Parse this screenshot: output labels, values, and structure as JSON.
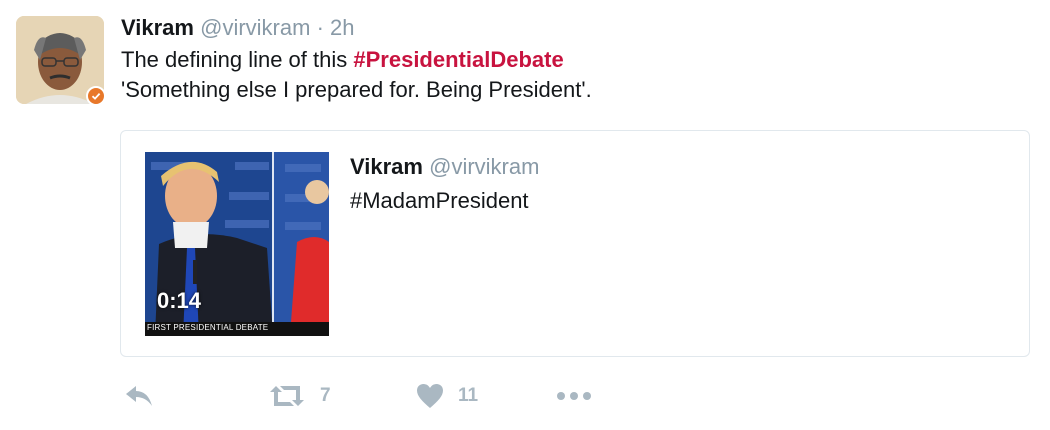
{
  "tweet": {
    "author_name": "Vikram",
    "author_handle": "@virvikram",
    "separator": "·",
    "time": "2h",
    "text_before_hashtag": "The defining line of this ",
    "hashtag": "#PresidentialDebate",
    "text_line2": "'Something else I prepared for. Being President'.",
    "verified": true
  },
  "quoted_tweet": {
    "author_name": "Vikram",
    "author_handle": "@virvikram",
    "text": "#MadamPresident",
    "video_duration": "0:14",
    "video_chyron": "FIRST PRESIDENTIAL DEBATE"
  },
  "actions": {
    "reply_icon": "reply-icon",
    "retweet_icon": "retweet-icon",
    "retweet_count": "7",
    "like_icon": "heart-icon",
    "like_count": "11",
    "more_icon": "more-dots-icon"
  },
  "colors": {
    "hashtag": "#c8133f",
    "muted": "#8899a6",
    "action_icon": "#aab8c2",
    "card_border": "#e1e8ed",
    "verified_badge": "#e8782a"
  }
}
